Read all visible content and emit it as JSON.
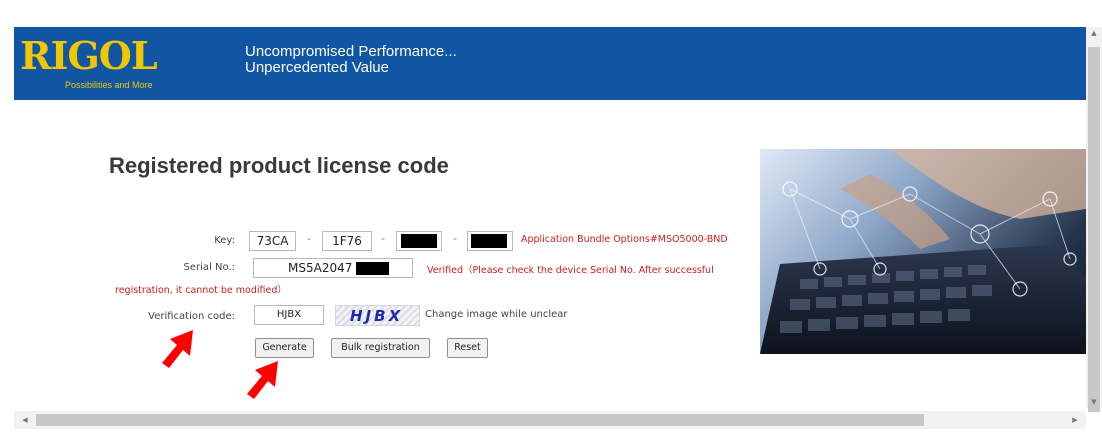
{
  "header": {
    "logo_text": "RIGOL",
    "logo_tagline": "Possibilities and More",
    "slogan_line1": "Uncompromised Performance...",
    "slogan_line2": "Unpercedented Value",
    "background_color": "#1155a5",
    "logo_color": "#f1c700"
  },
  "page_title": "Registered product license code",
  "form": {
    "key_label": "Key:",
    "key_segments": [
      "73CA",
      "1F76",
      "",
      ""
    ],
    "key_segment_redacted": [
      false,
      false,
      true,
      true
    ],
    "key_separator": "-",
    "key_status": "Application Bundle Options#MSO5000-BND",
    "serial_label": "Serial No.:",
    "serial_value": "MS5A2047",
    "serial_status_line1": "Verified（Please check the device Serial No. After successful",
    "serial_status_line2": "registration, it cannot be modified）",
    "verification_label": "Verification code:",
    "verification_value": "HJBX",
    "captcha_text": "HJBX",
    "captcha_hint": "Change image while unclear"
  },
  "buttons": {
    "generate": "Generate",
    "bulk": "Bulk registration",
    "reset": "Reset"
  },
  "hero_image": "laptop-keyboard-hands-network-icons",
  "annotation_arrow_color": "#ff0000"
}
